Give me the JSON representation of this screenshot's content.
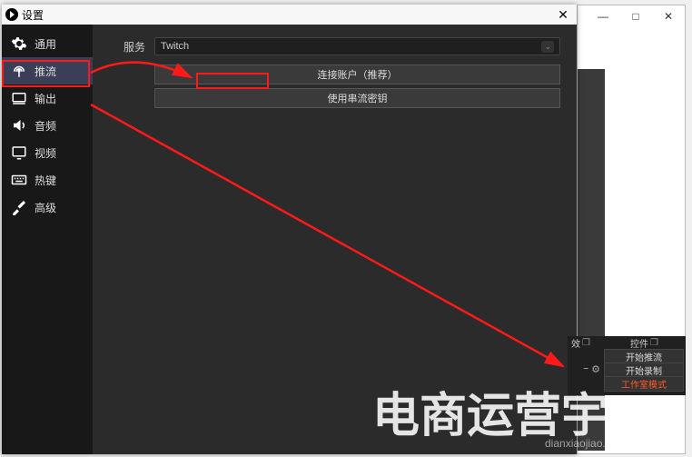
{
  "bgwin": {
    "min": "—",
    "max": "□",
    "close": "✕"
  },
  "titlebar": {
    "title": "设置",
    "close": "✕"
  },
  "sidebar": {
    "items": [
      {
        "label": "通用"
      },
      {
        "label": "推流"
      },
      {
        "label": "输出"
      },
      {
        "label": "音频"
      },
      {
        "label": "视频"
      },
      {
        "label": "热键"
      },
      {
        "label": "高级"
      }
    ]
  },
  "content": {
    "service_label": "服务",
    "service_value": "Twitch",
    "connect_btn": "连接账户（推荐）",
    "streamkey_btn": "使用串流密钥"
  },
  "panel": {
    "col1": "效",
    "col2": "控件",
    "pop": "❐",
    "rows": [
      {
        "label": "开始推流"
      },
      {
        "label": "开始录制"
      },
      {
        "label": "工作室模式",
        "hot": true
      }
    ],
    "minus": "−",
    "gear": "⚙"
  },
  "watermark": {
    "main": "电商运营宇",
    "sub": "dianxiaojiao.com"
  }
}
